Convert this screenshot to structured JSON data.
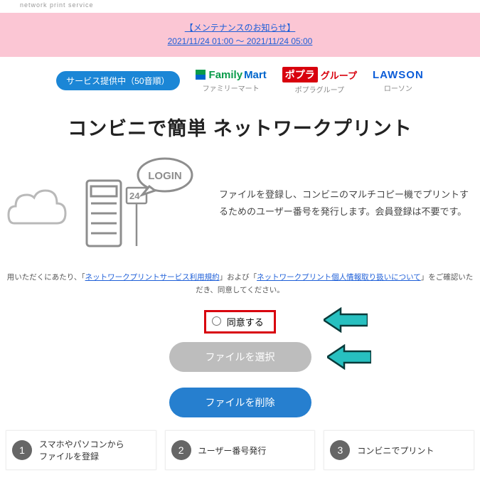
{
  "tagline": "network print service",
  "notice": {
    "title": "【メンテナンスのお知らせ】",
    "time": "2021/11/24 01:00 ～ 2021/11/24 05:00"
  },
  "service_badge": "サービス提供中（50音順）",
  "stores": {
    "familymart": {
      "brand_a": "Family",
      "brand_b": "Mart",
      "sub": "ファミリーマート"
    },
    "poplar": {
      "badge": "ポプラ",
      "text": "グループ",
      "sub": "ポプラグループ"
    },
    "lawson": {
      "brand": "LAWSON",
      "sub": "ローソン"
    }
  },
  "headline": "コンビニで簡単 ネットワークプリント",
  "hero_login": "LOGIN",
  "hero_24": "24",
  "hero_desc": "ファイルを登録し、コンビニのマルチコピー機でプリントするためのユーザー番号を発行します。会員登録は不要です。",
  "terms": {
    "prefix": "用いただくにあたり、「",
    "link1": "ネットワークプリントサービス利用規約",
    "mid": "」および「",
    "link2": "ネットワークプリント個人情報取り扱いについて",
    "suffix": "」をご確認いただき、同意してください。"
  },
  "agree_label": "同意する",
  "btn_select": "ファイルを選択",
  "btn_delete": "ファイルを削除",
  "steps": [
    {
      "num": "1",
      "text": "スマホやパソコンから\nファイルを登録"
    },
    {
      "num": "2",
      "text": "ユーザー番号発行"
    },
    {
      "num": "3",
      "text": "コンビニでプリント"
    }
  ]
}
